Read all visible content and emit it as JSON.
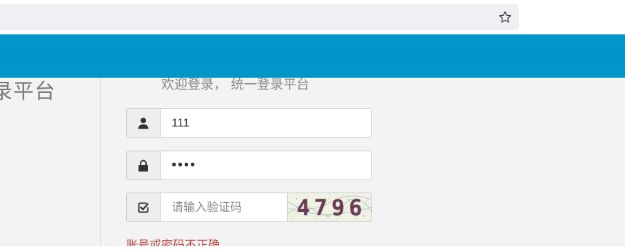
{
  "browser": {
    "star_icon": "star-outline-icon"
  },
  "header": {
    "color": "#0096c9"
  },
  "left_panel": {
    "title": "录平台"
  },
  "login": {
    "welcome": "欢迎登录， 统一登录平台",
    "username": {
      "icon": "user-icon",
      "value": "111"
    },
    "password": {
      "icon": "lock-icon",
      "value": "••••"
    },
    "captcha": {
      "icon": "check-square-icon",
      "placeholder": "请输入验证码",
      "image_text": "4796"
    },
    "error": "账号或密码不正确",
    "error_color": "#b84a4a"
  }
}
